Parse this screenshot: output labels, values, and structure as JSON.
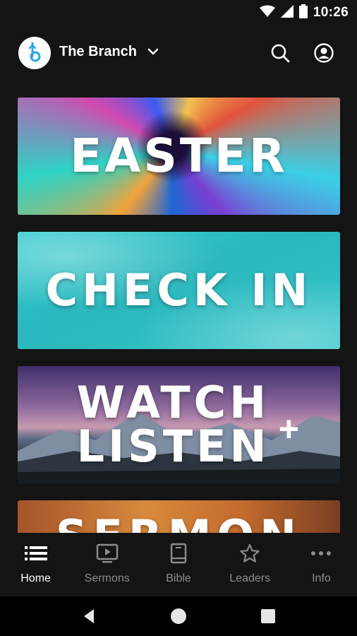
{
  "status_bar": {
    "time": "10:26",
    "icons": [
      "wifi-icon",
      "signal-icon",
      "battery-icon"
    ]
  },
  "header": {
    "title": "The Branch",
    "logo_letter": "b",
    "logo_color": "#29a9e0",
    "actions": [
      "search-icon",
      "account-icon"
    ]
  },
  "cards": [
    {
      "id": "easter",
      "title": "EASTER"
    },
    {
      "id": "check-in",
      "title": "CHECK IN"
    },
    {
      "id": "watch-listen",
      "line1": "WATCH",
      "line2": "LISTEN",
      "suffix": "+"
    },
    {
      "id": "sermon",
      "title": "SERMON"
    }
  ],
  "bottom_nav": {
    "active_color": "#ffffff",
    "inactive_color": "#8c8c8c",
    "items": [
      {
        "label": "Home",
        "icon": "list-icon",
        "active": true
      },
      {
        "label": "Sermons",
        "icon": "play-screen-icon",
        "active": false
      },
      {
        "label": "Bible",
        "icon": "book-icon",
        "active": false
      },
      {
        "label": "Leaders",
        "icon": "star-icon",
        "active": false
      },
      {
        "label": "Info",
        "icon": "more-dots-icon",
        "active": false
      }
    ]
  },
  "system_nav": [
    "back-icon",
    "home-circle-icon",
    "recents-square-icon"
  ]
}
